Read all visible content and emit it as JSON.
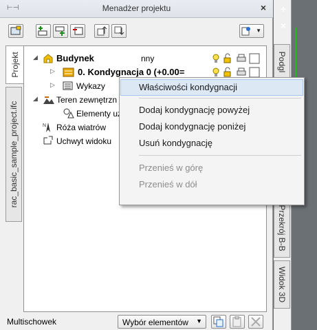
{
  "window": {
    "title": "Menadżer projektu",
    "close_glyph": "×",
    "grip_glyph": "⊢⊣"
  },
  "left_tabs": [
    {
      "label": "Projekt"
    },
    {
      "label": "rac_basic_sample_project.ifc"
    }
  ],
  "tree": {
    "rows": [
      {
        "label": "Budynek",
        "suffix": "nny"
      },
      {
        "label": "0. Kondygnacja 0 (+0.00="
      },
      {
        "label": "Wykazy"
      },
      {
        "label": "Teren zewnętrzn"
      },
      {
        "label": "Elementy uży"
      },
      {
        "label": "Róża wiatrów"
      },
      {
        "label": "Uchwyt widoku"
      }
    ]
  },
  "context_menu": {
    "items": [
      {
        "label": "Właściwości kondygnacji"
      },
      {
        "label": "Dodaj kondygnację powyżej"
      },
      {
        "label": "Dodaj kondygnację poniżej"
      },
      {
        "label": "Usuń kondygnację"
      },
      {
        "label": "Przenieś w górę"
      },
      {
        "label": "Przenieś w dół"
      }
    ]
  },
  "right_tabs": [
    {
      "label": "Podgl"
    },
    {
      "label": "Przekrój B-B"
    },
    {
      "label": "Widok 3D"
    }
  ],
  "right_buttons": {
    "plus": "+",
    "close": "×"
  },
  "bottom": {
    "label": "Multischowek",
    "selection": "Wybór elementów",
    "combo_arrow": "▼"
  },
  "colors": {
    "accent_highlight": "#dde8f5",
    "building_icon": "#f2c200",
    "storey_icon": "#e8a900"
  }
}
